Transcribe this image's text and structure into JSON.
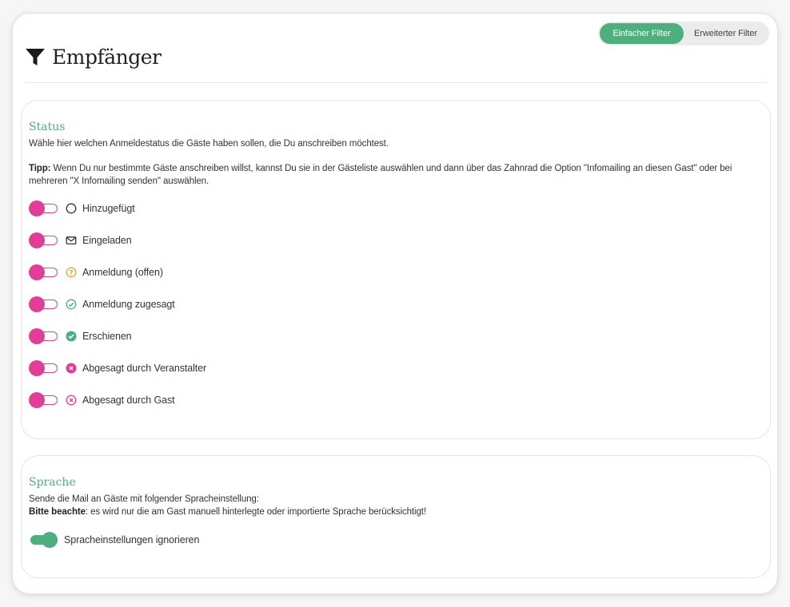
{
  "filter_toggle": {
    "simple": "Einfacher Filter",
    "advanced": "Erweiterter Filter",
    "active": "simple"
  },
  "header": {
    "title": "Empfänger",
    "icon": "funnel-icon"
  },
  "status": {
    "title": "Status",
    "description": "Wähle hier welchen Anmeldestatus die Gäste haben sollen, die Du anschreiben möchtest.",
    "tip_label": "Tipp:",
    "tip_text": " Wenn Du nur bestimmte Gäste anschreiben willst, kannst Du sie in der Gästeliste auswählen und dann über das Zahnrad die Option \"Infomailing an diesen Gast\" oder bei",
    "tip_text_2": "mehreren \"X Infomailing senden\" auswählen.",
    "items": [
      {
        "label": "Hinzugefügt",
        "icon": "circle-outline-icon",
        "icon_color": "#333333",
        "enabled": false
      },
      {
        "label": "Eingeladen",
        "icon": "envelope-icon",
        "icon_color": "#333333",
        "enabled": false
      },
      {
        "label": "Anmeldung (offen)",
        "icon": "question-circle-icon",
        "icon_color": "#e8a33a",
        "enabled": false
      },
      {
        "label": "Anmeldung zugesagt",
        "icon": "check-circle-outline-icon",
        "icon_color": "#4caf7d",
        "enabled": false
      },
      {
        "label": "Erschienen",
        "icon": "check-circle-filled-icon",
        "icon_color": "#4caf7d",
        "enabled": false
      },
      {
        "label": "Abgesagt durch Veranstalter",
        "icon": "x-circle-filled-icon",
        "icon_color": "#e13f96",
        "enabled": false
      },
      {
        "label": "Abgesagt durch Gast",
        "icon": "x-circle-outline-icon",
        "icon_color": "#e13f96",
        "enabled": false
      }
    ]
  },
  "language": {
    "title": "Sprache",
    "description": "Sende die Mail an Gäste mit folgender Spracheinstellung:",
    "note_label": "Bitte beachte",
    "note_text": ": es wird nur die am Gast manuell hinterlegte oder importierte Sprache berücksichtigt!",
    "toggle_label": "Spracheinstellungen ignorieren",
    "toggle_enabled": true
  },
  "colors": {
    "accent_green": "#4caf7d",
    "accent_pink": "#e13f96",
    "warning_orange": "#e8a33a"
  }
}
